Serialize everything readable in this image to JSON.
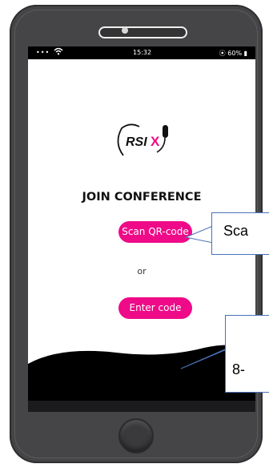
{
  "status_bar": {
    "signal": "•••",
    "time": "15:32",
    "battery": "⦿ 60% ▮"
  },
  "logo": {
    "text_rsi": "RSI",
    "text_x": "X"
  },
  "screen": {
    "title": "JOIN CONFERENCE",
    "scan_button": "Scan QR-code",
    "or_text": "or",
    "code_button": "Enter code"
  },
  "annotations": {
    "callout_scan": "Sca",
    "callout_code": "8-"
  },
  "colors": {
    "accent": "#ef0a88",
    "phone_body": "#454548",
    "callout_border": "#4a72b8"
  },
  "icons": [
    "wifi-icon",
    "battery-icon",
    "signal-icon",
    "microphone-icon",
    "home-button-icon"
  ]
}
